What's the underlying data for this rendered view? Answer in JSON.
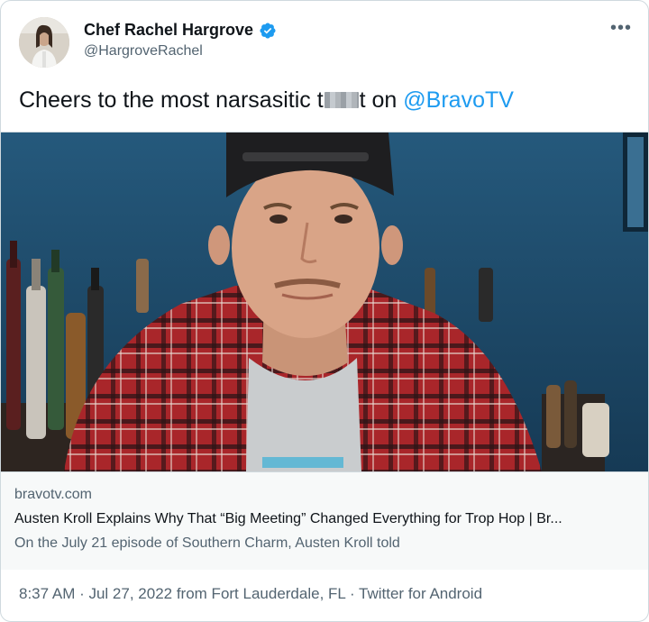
{
  "author": {
    "display_name": "Chef Rachel Hargrove",
    "handle": "@HargroveRachel",
    "verified": true
  },
  "tweet": {
    "text_before": "Cheers to the most narsasitic t",
    "text_after": "t on",
    "mention": "@BravoTV"
  },
  "card": {
    "domain": "bravotv.com",
    "title": "Austen Kroll Explains Why That “Big Meeting” Changed Everything for Trop Hop | Br...",
    "description": "On the July 21 episode of Southern Charm, Austen Kroll told"
  },
  "meta": {
    "timestamp": "8:37 AM · Jul 27, 2022 from Fort Lauderdale, FL · Twitter for Android"
  },
  "colors": {
    "link": "#1d9bf0",
    "secondary_text": "#536471",
    "wall_blue": "#1f4e6e",
    "shirt_red": "#b3262b"
  },
  "icons": {
    "verified": "verified-badge-icon",
    "more": "more-options-icon"
  }
}
